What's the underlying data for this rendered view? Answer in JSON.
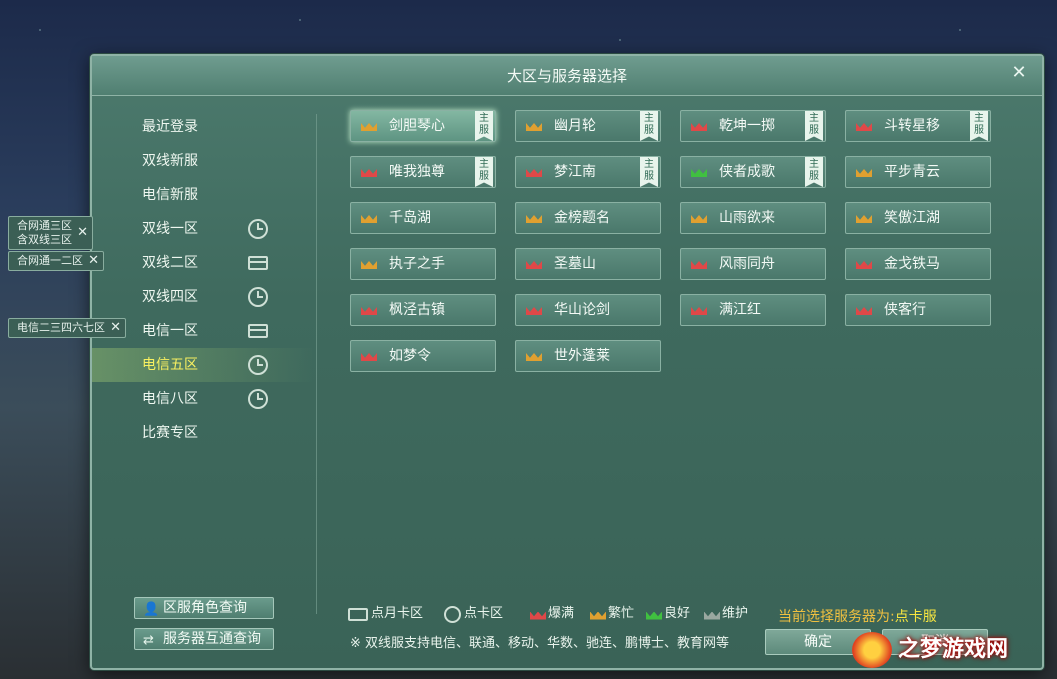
{
  "window": {
    "title": "大区与服务器选择"
  },
  "sidebar": {
    "items": [
      {
        "label": "最近登录",
        "icon": "",
        "active": false
      },
      {
        "label": "双线新服",
        "icon": "",
        "active": false
      },
      {
        "label": "电信新服",
        "icon": "",
        "active": false
      },
      {
        "label": "双线一区",
        "icon": "clock-icon",
        "active": false
      },
      {
        "label": "双线二区",
        "icon": "card-icon",
        "active": false
      },
      {
        "label": "双线四区",
        "icon": "clock-icon",
        "active": false
      },
      {
        "label": "电信一区",
        "icon": "card-icon",
        "active": false
      },
      {
        "label": "电信五区",
        "icon": "clock-icon",
        "active": true
      },
      {
        "label": "电信八区",
        "icon": "clock-icon",
        "active": false
      },
      {
        "label": "比赛专区",
        "icon": "",
        "active": false
      }
    ],
    "merge_tags": [
      {
        "line1": "合网通三区",
        "line2": "含双线三区"
      },
      {
        "line1": "合网通一二区",
        "line2": ""
      },
      {
        "line1": "电信二三四六七区",
        "line2": ""
      }
    ],
    "buttons": {
      "role_query": "区服角色查询",
      "interop_query": "服务器互通查询"
    }
  },
  "servers": [
    {
      "name": "剑胆琴心",
      "status": "busy",
      "main": true,
      "selected": true
    },
    {
      "name": "幽月轮",
      "status": "busy",
      "main": true,
      "selected": false
    },
    {
      "name": "乾坤一掷",
      "status": "full",
      "main": true,
      "selected": false
    },
    {
      "name": "斗转星移",
      "status": "full",
      "main": true,
      "selected": false
    },
    {
      "name": "唯我独尊",
      "status": "full",
      "main": true,
      "selected": false
    },
    {
      "name": "梦江南",
      "status": "full",
      "main": true,
      "selected": false
    },
    {
      "name": "侠者成歌",
      "status": "good",
      "main": true,
      "selected": false
    },
    {
      "name": "平步青云",
      "status": "busy",
      "main": false,
      "selected": false
    },
    {
      "name": "千岛湖",
      "status": "busy",
      "main": false,
      "selected": false
    },
    {
      "name": "金榜题名",
      "status": "busy",
      "main": false,
      "selected": false
    },
    {
      "name": "山雨欲来",
      "status": "busy",
      "main": false,
      "selected": false
    },
    {
      "name": "笑傲江湖",
      "status": "busy",
      "main": false,
      "selected": false
    },
    {
      "name": "执子之手",
      "status": "busy",
      "main": false,
      "selected": false
    },
    {
      "name": "圣墓山",
      "status": "full",
      "main": false,
      "selected": false
    },
    {
      "name": "风雨同舟",
      "status": "full",
      "main": false,
      "selected": false
    },
    {
      "name": "金戈铁马",
      "status": "full",
      "main": false,
      "selected": false
    },
    {
      "name": "枫泾古镇",
      "status": "full",
      "main": false,
      "selected": false
    },
    {
      "name": "华山论剑",
      "status": "full",
      "main": false,
      "selected": false
    },
    {
      "name": "满江红",
      "status": "full",
      "main": false,
      "selected": false
    },
    {
      "name": "侠客行",
      "status": "full",
      "main": false,
      "selected": false
    },
    {
      "name": "如梦令",
      "status": "full",
      "main": false,
      "selected": false
    },
    {
      "name": "世外蓬莱",
      "status": "busy",
      "main": false,
      "selected": false
    }
  ],
  "main_badge_text": "主服",
  "status_colors": {
    "full": "#e04848",
    "busy": "#e0a030",
    "good": "#40c040",
    "maintenance": "#9aa8a0"
  },
  "legend": {
    "monthly_card": "点月卡区",
    "point_card": "点卡区",
    "full": "爆满",
    "busy": "繁忙",
    "good": "良好",
    "maintenance": "维护"
  },
  "current_selection": {
    "label": "当前选择服务器为:",
    "value": "点卡服"
  },
  "note": "※ 双线服支持电信、联通、移动、华数、驰连、鹏博士、教育网等",
  "actions": {
    "confirm": "确定",
    "cancel": "取消"
  },
  "watermark": "之梦游戏网"
}
